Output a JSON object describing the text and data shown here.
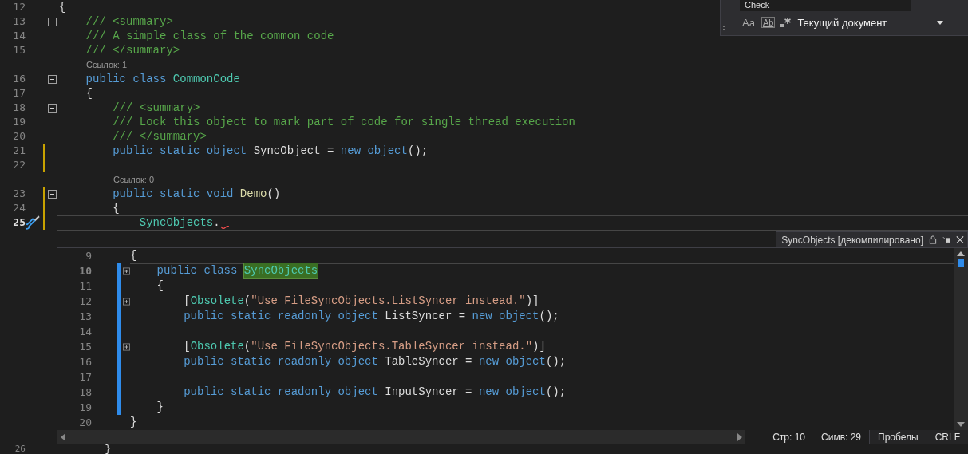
{
  "find_widget": {
    "value": "Check",
    "options": [
      "Aa",
      "Ab"
    ],
    "scope": "Текущий документ"
  },
  "editor": {
    "lines": [
      {
        "kind": "code",
        "number": "12",
        "fold": false,
        "changed": false,
        "current": false,
        "error": false,
        "quick_action": false,
        "tokens": [
          {
            "text": "{",
            "kind": "plain"
          }
        ]
      },
      {
        "kind": "code",
        "number": "13",
        "fold": true,
        "changed": false,
        "current": false,
        "error": false,
        "quick_action": false,
        "tokens": [
          {
            "text": "    /// <summary>",
            "kind": "comment"
          }
        ]
      },
      {
        "kind": "code",
        "number": "14",
        "fold": false,
        "changed": false,
        "current": false,
        "error": false,
        "quick_action": false,
        "tokens": [
          {
            "text": "    /// A simple class of the common code",
            "kind": "comment"
          }
        ]
      },
      {
        "kind": "code",
        "number": "15",
        "fold": false,
        "changed": false,
        "current": false,
        "error": false,
        "quick_action": false,
        "tokens": [
          {
            "text": "    /// </summary>",
            "kind": "comment"
          }
        ]
      },
      {
        "kind": "codelens",
        "text": "Ссылок: 1",
        "nested": false
      },
      {
        "kind": "code",
        "number": "16",
        "fold": true,
        "changed": false,
        "current": false,
        "error": false,
        "quick_action": false,
        "tokens": [
          {
            "text": "    public class ",
            "kind": "keyword"
          },
          {
            "text": "CommonCode",
            "kind": "type"
          }
        ]
      },
      {
        "kind": "code",
        "number": "17",
        "fold": false,
        "changed": false,
        "current": false,
        "error": false,
        "quick_action": false,
        "tokens": [
          {
            "text": "    {",
            "kind": "plain"
          }
        ]
      },
      {
        "kind": "code",
        "number": "18",
        "fold": true,
        "changed": false,
        "current": false,
        "error": false,
        "quick_action": false,
        "tokens": [
          {
            "text": "        /// <summary>",
            "kind": "comment"
          }
        ]
      },
      {
        "kind": "code",
        "number": "19",
        "fold": false,
        "changed": false,
        "current": false,
        "error": false,
        "quick_action": false,
        "tokens": [
          {
            "text": "        /// Lock this object to mark part of code for single thread execution",
            "kind": "comment"
          }
        ]
      },
      {
        "kind": "code",
        "number": "20",
        "fold": false,
        "changed": false,
        "current": false,
        "error": false,
        "quick_action": false,
        "tokens": [
          {
            "text": "        /// </summary>",
            "kind": "comment"
          }
        ]
      },
      {
        "kind": "code",
        "number": "21",
        "fold": false,
        "changed": true,
        "current": false,
        "error": false,
        "quick_action": false,
        "tokens": [
          {
            "text": "        public static object ",
            "kind": "keyword"
          },
          {
            "text": "SyncObject = ",
            "kind": "plain"
          },
          {
            "text": "new object",
            "kind": "keyword"
          },
          {
            "text": "();",
            "kind": "plain"
          }
        ]
      },
      {
        "kind": "code",
        "number": "22",
        "fold": false,
        "changed": true,
        "current": false,
        "error": false,
        "quick_action": false
      },
      {
        "kind": "codelens",
        "text": "Ссылок: 0",
        "nested": true
      },
      {
        "kind": "code",
        "number": "23",
        "fold": true,
        "changed": true,
        "current": false,
        "error": false,
        "quick_action": false,
        "tokens": [
          {
            "text": "        public static void ",
            "kind": "keyword"
          },
          {
            "text": "Demo",
            "kind": "method"
          },
          {
            "text": "()",
            "kind": "plain"
          }
        ]
      },
      {
        "kind": "code",
        "number": "24",
        "fold": false,
        "changed": true,
        "current": false,
        "error": false,
        "quick_action": false,
        "tokens": [
          {
            "text": "        {",
            "kind": "plain"
          }
        ]
      },
      {
        "kind": "code",
        "number": "25",
        "fold": false,
        "changed": true,
        "current": true,
        "error": true,
        "quick_action": true,
        "tokens": [
          {
            "text": "            SyncObjects",
            "kind": "type"
          },
          {
            "text": ".",
            "kind": "plain"
          }
        ]
      }
    ],
    "last_line": {
      "number": "26",
      "tokens": [
        {
          "text": "        }",
          "kind": "plain"
        }
      ]
    }
  },
  "peek": {
    "title": "SyncObjects [декомпилировано]",
    "lines": [
      {
        "number": "9",
        "fold": false,
        "changed": false,
        "current": false,
        "tokens": [
          {
            "text": "{",
            "kind": "plain"
          }
        ]
      },
      {
        "number": "10",
        "fold": true,
        "changed": true,
        "current": true,
        "tokens": [
          {
            "text": "    public class ",
            "kind": "keyword"
          },
          {
            "text": "SyncObjects",
            "kind": "highlight"
          }
        ]
      },
      {
        "number": "11",
        "fold": false,
        "changed": true,
        "current": false,
        "tokens": [
          {
            "text": "    {",
            "kind": "plain"
          }
        ]
      },
      {
        "number": "12",
        "fold": true,
        "changed": true,
        "current": false,
        "tokens": [
          {
            "text": "        [",
            "kind": "plain"
          },
          {
            "text": "Obsolete",
            "kind": "type"
          },
          {
            "text": "(",
            "kind": "plain"
          },
          {
            "text": "\"Use FileSyncObjects.ListSyncer instead.\"",
            "kind": "string"
          },
          {
            "text": ")]",
            "kind": "plain"
          }
        ]
      },
      {
        "number": "13",
        "fold": false,
        "changed": true,
        "current": false,
        "tokens": [
          {
            "text": "        public static readonly object ",
            "kind": "keyword"
          },
          {
            "text": "ListSyncer = ",
            "kind": "plain"
          },
          {
            "text": "new object",
            "kind": "keyword"
          },
          {
            "text": "();",
            "kind": "plain"
          }
        ]
      },
      {
        "number": "14",
        "fold": false,
        "changed": true,
        "current": false
      },
      {
        "number": "15",
        "fold": true,
        "changed": true,
        "current": false,
        "tokens": [
          {
            "text": "        [",
            "kind": "plain"
          },
          {
            "text": "Obsolete",
            "kind": "type"
          },
          {
            "text": "(",
            "kind": "plain"
          },
          {
            "text": "\"Use FileSyncObjects.TableSyncer instead.\"",
            "kind": "string"
          },
          {
            "text": ")]",
            "kind": "plain"
          }
        ]
      },
      {
        "number": "16",
        "fold": false,
        "changed": true,
        "current": false,
        "tokens": [
          {
            "text": "        public static readonly object ",
            "kind": "keyword"
          },
          {
            "text": "TableSyncer = ",
            "kind": "plain"
          },
          {
            "text": "new object",
            "kind": "keyword"
          },
          {
            "text": "();",
            "kind": "plain"
          }
        ]
      },
      {
        "number": "17",
        "fold": false,
        "changed": true,
        "current": false
      },
      {
        "number": "18",
        "fold": false,
        "changed": true,
        "current": false,
        "tokens": [
          {
            "text": "        public static readonly object ",
            "kind": "keyword"
          },
          {
            "text": "InputSyncer = ",
            "kind": "plain"
          },
          {
            "text": "new object",
            "kind": "keyword"
          },
          {
            "text": "();",
            "kind": "plain"
          }
        ]
      },
      {
        "number": "19",
        "fold": false,
        "changed": true,
        "current": false,
        "tokens": [
          {
            "text": "    }",
            "kind": "plain"
          }
        ]
      },
      {
        "number": "20",
        "fold": false,
        "changed": false,
        "current": false,
        "tokens": [
          {
            "text": "}",
            "kind": "plain"
          }
        ]
      }
    ],
    "status": [
      {
        "text": "Стр: 10",
        "kind": "label"
      },
      {
        "text": "Симв: 29",
        "kind": "label"
      },
      {
        "text": "Пробелы",
        "kind": "button"
      },
      {
        "text": "CRLF",
        "kind": "button"
      }
    ]
  }
}
